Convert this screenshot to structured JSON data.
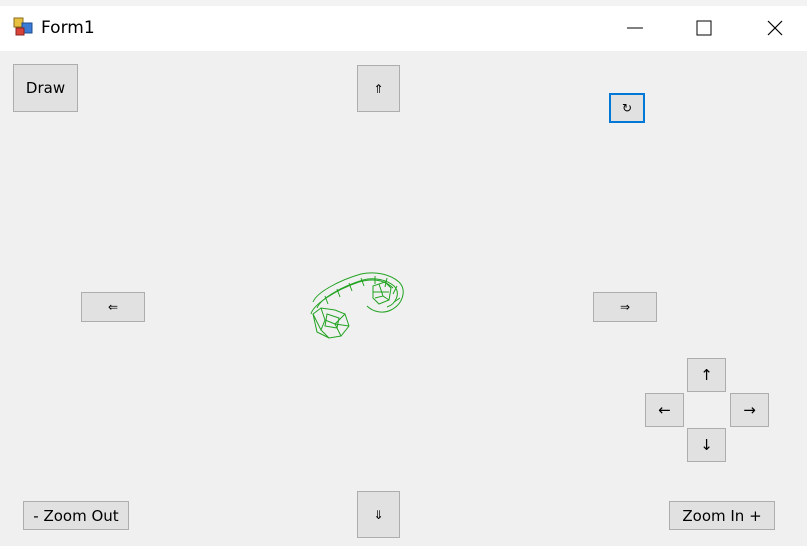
{
  "window": {
    "title": "Form1",
    "controls": [
      "minimize-icon",
      "maximize-icon",
      "close-icon"
    ]
  },
  "buttons": {
    "draw": "Draw",
    "rotate_up": "⇑",
    "rotate_down": "⇓",
    "rotate_left": "⇐",
    "rotate_right": "⇒",
    "rotate": "↻",
    "move_up": "↑",
    "move_down": "↓",
    "move_left": "←",
    "move_right": "→",
    "zoom_out": "- Zoom Out",
    "zoom_in": "Zoom In +"
  },
  "colors": {
    "wireframe": "#22a322",
    "focus": "#0078d7"
  }
}
